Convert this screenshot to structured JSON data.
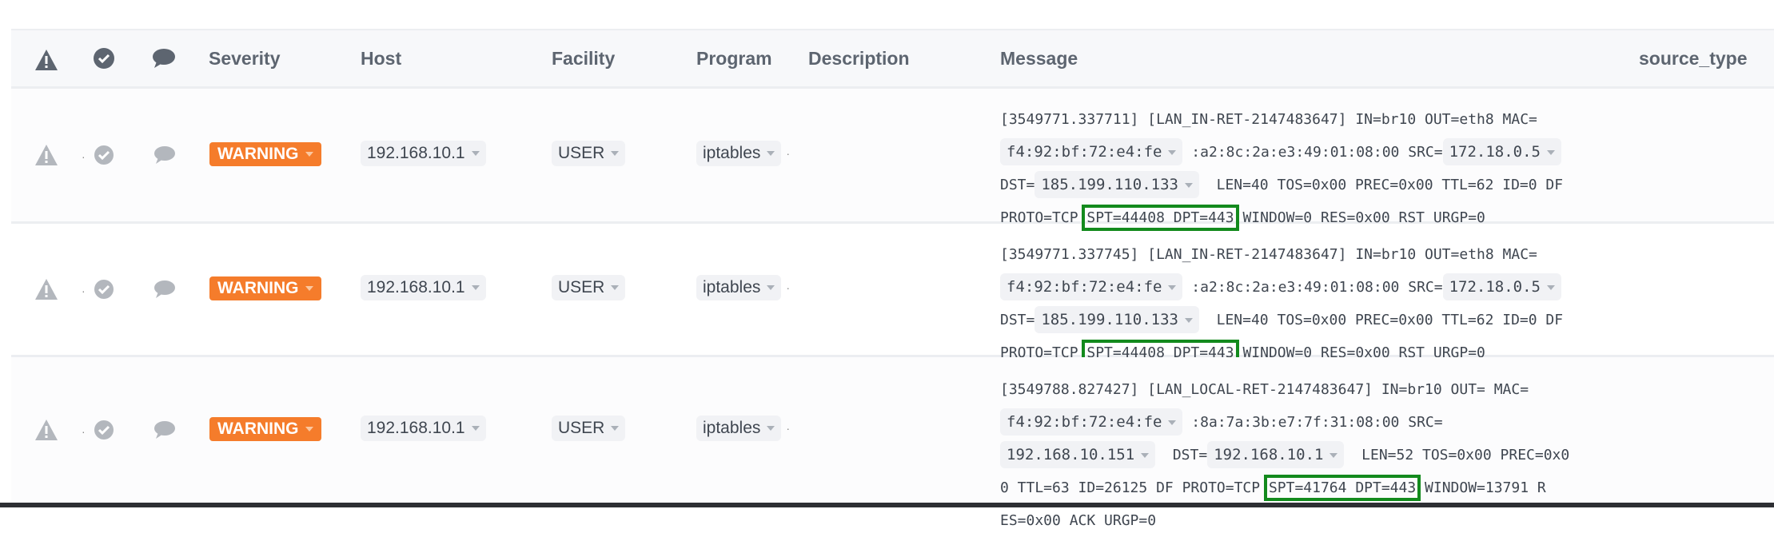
{
  "header": {
    "severity": "Severity",
    "host": "Host",
    "facility": "Facility",
    "program": "Program",
    "description": "Description",
    "message": "Message",
    "source_type": "source_type"
  },
  "colors": {
    "warning": "#f57c2b",
    "highlight": "#138a1d"
  },
  "rows": [
    {
      "severity": "WARNING",
      "host": "192.168.10.1",
      "facility": "USER",
      "program": "iptables",
      "message": [
        [
          {
            "t": "[3549771.337711] [LAN_IN-RET-2147483647] IN=br10 OUT=eth8 MAC="
          }
        ],
        [
          {
            "t": "f4:92:bf:72:e4:fe",
            "tag": true
          },
          {
            "t": " :a2:8c:2a:e3:49:01:08:00 SRC="
          },
          {
            "t": "172.18.0.5",
            "tag": true
          }
        ],
        [
          {
            "t": "DST="
          },
          {
            "t": "185.199.110.133",
            "tag": true
          },
          {
            "t": "  LEN=40 TOS=0x00 PREC=0x00 TTL=62 ID=0 DF"
          }
        ],
        [
          {
            "t": "PROTO=TCP "
          },
          {
            "t": "SPT=44408 DPT=443",
            "hl": true
          },
          {
            "t": " WINDOW=0 RES=0x00 RST URGP=0"
          }
        ]
      ]
    },
    {
      "severity": "WARNING",
      "host": "192.168.10.1",
      "facility": "USER",
      "program": "iptables",
      "message": [
        [
          {
            "t": "[3549771.337745] [LAN_IN-RET-2147483647] IN=br10 OUT=eth8 MAC="
          }
        ],
        [
          {
            "t": "f4:92:bf:72:e4:fe",
            "tag": true
          },
          {
            "t": " :a2:8c:2a:e3:49:01:08:00 SRC="
          },
          {
            "t": "172.18.0.5",
            "tag": true
          }
        ],
        [
          {
            "t": "DST="
          },
          {
            "t": "185.199.110.133",
            "tag": true
          },
          {
            "t": "  LEN=40 TOS=0x00 PREC=0x00 TTL=62 ID=0 DF"
          }
        ],
        [
          {
            "t": "PROTO=TCP "
          },
          {
            "t": "SPT=44408 DPT=443",
            "hl": true
          },
          {
            "t": " WINDOW=0 RES=0x00 RST URGP=0"
          }
        ]
      ]
    },
    {
      "severity": "WARNING",
      "host": "192.168.10.1",
      "facility": "USER",
      "program": "iptables",
      "message": [
        [
          {
            "t": "[3549788.827427] [LAN_LOCAL-RET-2147483647] IN=br10 OUT= MAC="
          }
        ],
        [
          {
            "t": "f4:92:bf:72:e4:fe",
            "tag": true
          },
          {
            "t": " :8a:7a:3b:e7:7f:31:08:00 SRC="
          }
        ],
        [
          {
            "t": "192.168.10.151",
            "tag": true
          },
          {
            "t": "  DST="
          },
          {
            "t": "192.168.10.1",
            "tag": true
          },
          {
            "t": "  LEN=52 TOS=0x00 PREC=0x0"
          }
        ],
        [
          {
            "t": "0 TTL=63 ID=26125 DF PROTO=TCP "
          },
          {
            "t": "SPT=41764 DPT=443",
            "hl": true
          },
          {
            "t": " WINDOW=13791 R"
          }
        ],
        [
          {
            "t": "ES=0x00 ACK URGP=0"
          }
        ]
      ]
    }
  ]
}
